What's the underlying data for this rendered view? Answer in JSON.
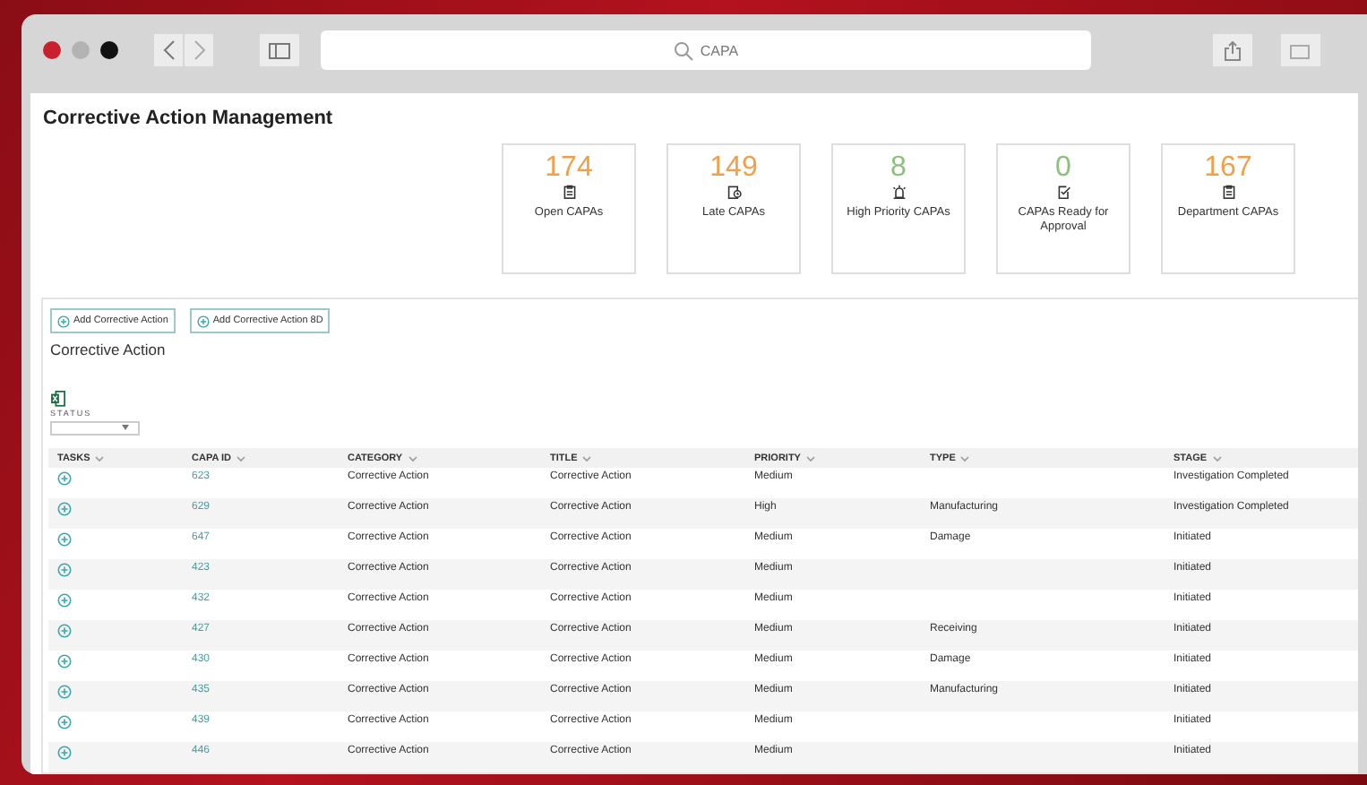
{
  "browser": {
    "address": "CAPA"
  },
  "page": {
    "title": "Corrective Action Management"
  },
  "cards": [
    {
      "value": "174",
      "label": "Open CAPAs",
      "color": "#f0a04b"
    },
    {
      "value": "149",
      "label": "Late CAPAs",
      "color": "#f0a04b"
    },
    {
      "value": "8",
      "label": "High Priority CAPAs",
      "color": "#8bc17a"
    },
    {
      "value": "0",
      "label": "CAPAs Ready for Approval",
      "color": "#8bc17a"
    },
    {
      "value": "167",
      "label": "Department CAPAs",
      "color": "#f0a04b"
    }
  ],
  "actions": [
    "Add Corrective Action",
    "Add Corrective Action 8D"
  ],
  "section": {
    "title": "Corrective Action",
    "filter_label": "STATUS"
  },
  "table": {
    "columns": [
      "TASKS",
      "CAPA ID",
      "CATEGORY",
      "TITLE",
      "PRIORITY",
      "TYPE",
      "STAGE"
    ],
    "rows": [
      {
        "capa_id": "623",
        "category": "Corrective Action",
        "title": "Corrective Action",
        "priority": "Medium",
        "stage": "Investigation Completed"
      },
      {
        "capa_id": "629",
        "category": "Corrective Action",
        "title": "Corrective Action",
        "priority": "High",
        "type": "Manufacturing",
        "stage": "Investigation Completed"
      },
      {
        "capa_id": "647",
        "category": "Corrective Action",
        "title": "Corrective Action",
        "priority": "Medium",
        "type": "Damage",
        "stage": "Initiated"
      },
      {
        "capa_id": "423",
        "category": "Corrective Action",
        "title": "Corrective Action",
        "priority": "Medium",
        "stage": "Initiated"
      },
      {
        "capa_id": "432",
        "category": "Corrective Action",
        "title": "Corrective Action",
        "priority": "Medium",
        "stage": "Initiated"
      },
      {
        "capa_id": "427",
        "category": "Corrective Action",
        "title": "Corrective Action",
        "priority": "Medium",
        "type": "Receiving",
        "stage": "Initiated"
      },
      {
        "capa_id": "430",
        "category": "Corrective Action",
        "title": "Corrective Action",
        "priority": "Medium",
        "type": "Damage",
        "stage": "Initiated"
      },
      {
        "capa_id": "435",
        "category": "Corrective Action",
        "title": "Corrective Action",
        "priority": "Medium",
        "type": "Manufacturing",
        "stage": "Initiated"
      },
      {
        "capa_id": "439",
        "category": "Corrective Action",
        "title": "Corrective Action",
        "priority": "Medium",
        "stage": "Initiated"
      },
      {
        "capa_id": "446",
        "category": "Corrective Action",
        "title": "Corrective Action",
        "priority": "Medium",
        "stage": "Initiated"
      }
    ]
  }
}
